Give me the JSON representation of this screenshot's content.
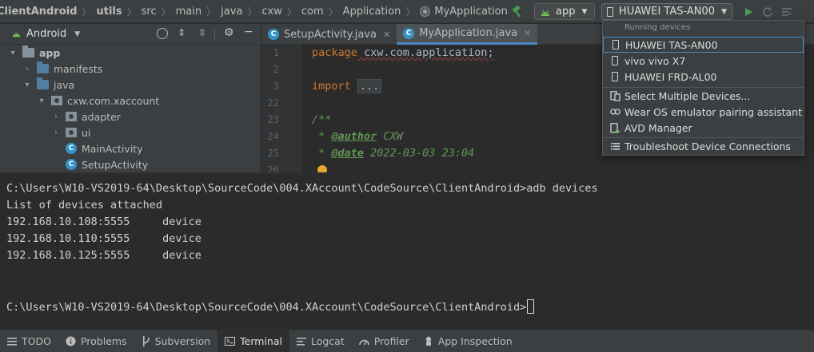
{
  "breadcrumbs": {
    "items": [
      "ClientAndroid",
      "utils",
      "src",
      "main",
      "java",
      "cxw",
      "com",
      "Application",
      "MyApplication"
    ]
  },
  "toolbar": {
    "run_config": "app",
    "device": "HUAWEI TAS-AN00",
    "accent_green": "#499c54"
  },
  "project": {
    "view_mode": "Android",
    "tree": [
      "app",
      "manifests",
      "java",
      "cxw.com.xaccount",
      "adapter",
      "ui",
      "MainActivity",
      "SetupActivity"
    ]
  },
  "editor": {
    "tabs": [
      "SetupActivity.java",
      "MyApplication.java"
    ],
    "line_numbers": [
      "1",
      "2",
      "3",
      "22",
      "23",
      "24",
      "25",
      "26"
    ],
    "code": {
      "pkg_kw": "package",
      "pkg_name": " cxw.com.application;",
      "import_kw": "import",
      "import_fold": "...",
      "doc_open": "/**",
      "author_prefix": " * ",
      "author_tag": "@author",
      "author_val": " CXW",
      "date_prefix": " * ",
      "date_tag": "@date",
      "date_val": " 2022-03-03 23:04"
    }
  },
  "terminal": {
    "lines": [
      "C:\\Users\\W10-VS2019-64\\Desktop\\SourceCode\\004.XAccount\\CodeSource\\ClientAndroid>adb devices",
      "List of devices attached",
      "192.168.10.108:5555     device",
      "192.168.10.110:5555     device",
      "192.168.10.125:5555     device",
      "",
      "",
      "C:\\Users\\W10-VS2019-64\\Desktop\\SourceCode\\004.XAccount\\CodeSource\\ClientAndroid>"
    ]
  },
  "bottom_tabs": [
    "TODO",
    "Problems",
    "Subversion",
    "Terminal",
    "Logcat",
    "Profiler",
    "App Inspection"
  ],
  "device_menu": {
    "header": "Running devices",
    "devices": [
      "HUAWEI TAS-AN00",
      "vivo vivo X7",
      "HUAWEI FRD-AL00"
    ],
    "actions": [
      "Select Multiple Devices...",
      "Wear OS emulator pairing assistant",
      "AVD Manager",
      "Troubleshoot Device Connections"
    ]
  }
}
